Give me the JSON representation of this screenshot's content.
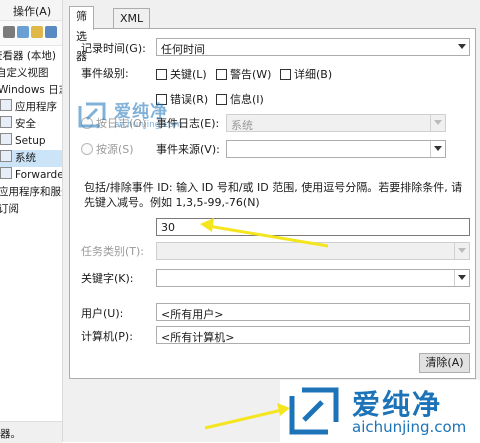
{
  "background_window": {
    "menu": "操作(A)",
    "tree": [
      {
        "label": "查看器 (本地)",
        "selected": false
      },
      {
        "label": "自定义视图",
        "selected": false
      },
      {
        "label": "Windows 日志",
        "selected": false
      },
      {
        "label": "应用程序",
        "selected": false
      },
      {
        "label": "安全",
        "selected": false
      },
      {
        "label": "Setup",
        "selected": false
      },
      {
        "label": "系统",
        "selected": true
      },
      {
        "label": "Forwarded",
        "selected": false
      },
      {
        "label": "应用程序和服务",
        "selected": false
      },
      {
        "label": "订阅",
        "selected": false
      }
    ],
    "status": "器。"
  },
  "dialog": {
    "tabs": [
      {
        "label": "筛选器",
        "active": true
      },
      {
        "label": "XML",
        "active": false
      }
    ],
    "logged_label": "记录时间(G):",
    "logged_value": "任何时间",
    "level_label": "事件级别:",
    "levels": {
      "critical": "关键(L)",
      "warning": "警告(W)",
      "verbose": "详细(B)",
      "error": "错误(R)",
      "info": "信息(I)"
    },
    "by_log_radio": "按日志(O)",
    "by_source_radio": "按源(S)",
    "event_log_label": "事件日志(E):",
    "event_log_value": "系统",
    "event_source_label": "事件来源(V):",
    "event_source_value": "",
    "description": "包括/排除事件 ID: 输入 ID 号和/或 ID 范围, 使用逗号分隔。若要排除条件, 请先键入减号。例如 1,3,5-99,-76(N)",
    "event_id_value": "30",
    "task_category_label": "任务类别(T):",
    "task_category_value": "",
    "keywords_label": "关键字(K):",
    "keywords_value": "",
    "user_label": "用户(U):",
    "user_value": "<所有用户>",
    "computer_label": "计算机(P):",
    "computer_value": "<所有计算机>",
    "clear_button": "清除(A)"
  },
  "watermark": {
    "brand": "爱纯净",
    "url": "aichunjing.com",
    "color": "#1c73b8"
  },
  "annotation": {
    "arrow_color": "#f5e51f"
  }
}
